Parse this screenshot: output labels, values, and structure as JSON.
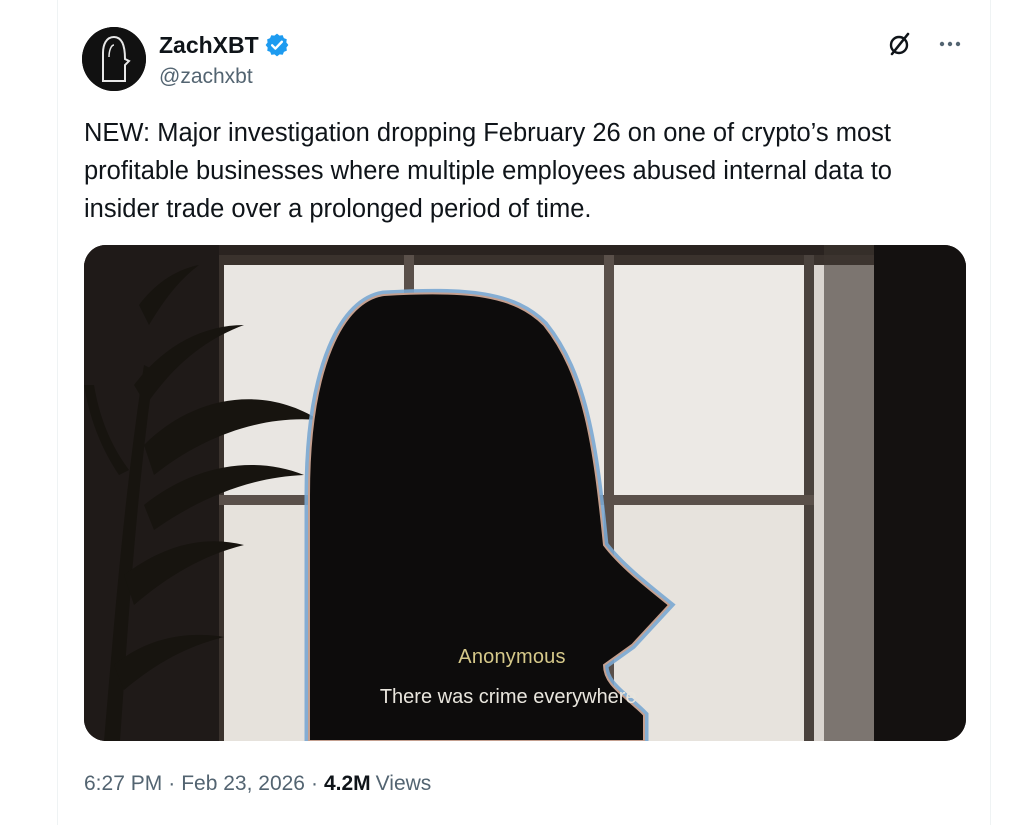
{
  "author": {
    "name": "ZachXBT",
    "handle": "@zachxbt",
    "verified": true,
    "verified_color": "#1d9bf0",
    "avatar_icon": "hooded-figure-avatar"
  },
  "header_actions": {
    "grok_icon": "grok-slash-icon",
    "more_icon": "more-dots-icon",
    "more_label": "···"
  },
  "tweet": {
    "text": "NEW: Major investigation dropping February 26 on one of crypto’s most\nprofitable businesses where multiple employees abused internal data to\ninsider trade over a prolonged period of time."
  },
  "media": {
    "caption_speaker": "Anonymous",
    "caption_line": "There was crime everywhere."
  },
  "meta": {
    "time": "6:27 PM",
    "date": "Feb 23, 2026",
    "views_count": "4.2M",
    "views_label": "Views",
    "separator": "·"
  }
}
